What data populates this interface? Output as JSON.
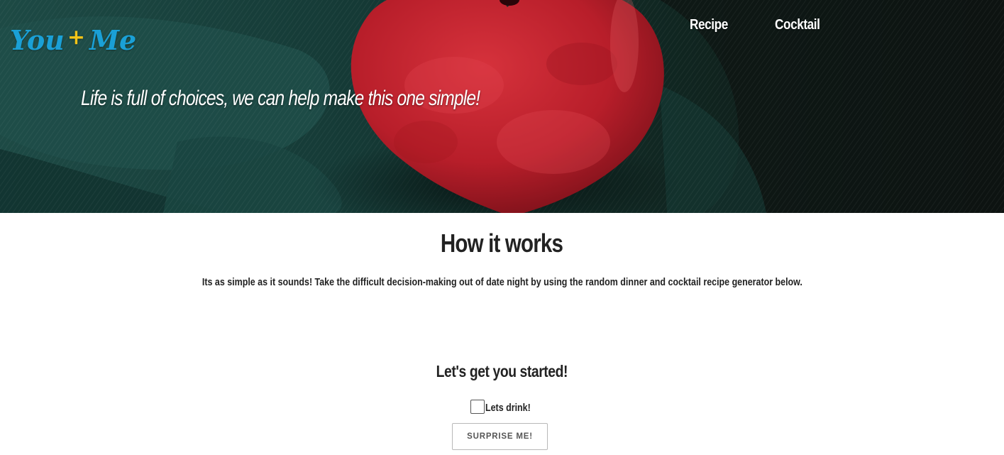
{
  "header": {
    "logo_left": "You",
    "logo_plus": "+",
    "logo_right": "Me",
    "tagline": "Life is full of choices, we can help make this one simple!",
    "background_image": "heart-on-green-fabric",
    "nav": [
      {
        "label": "Recipe"
      },
      {
        "label": "Cocktail"
      }
    ]
  },
  "main": {
    "how_title": "How it works",
    "how_text": "Its as simple as it sounds! Take the difficult decision-making out of date night by using the random dinner and cocktail recipe generator below.",
    "start_title": "Let's get you started!",
    "drink_checkbox": {
      "label": "Lets drink!",
      "checked": false
    },
    "surprise_button": "SURPRISE ME!"
  },
  "colors": {
    "logo_blue": "#1aa0d6",
    "logo_plus_yellow": "#f5c518",
    "heart_red": "#c8242f",
    "fabric_green": "#173c38"
  }
}
